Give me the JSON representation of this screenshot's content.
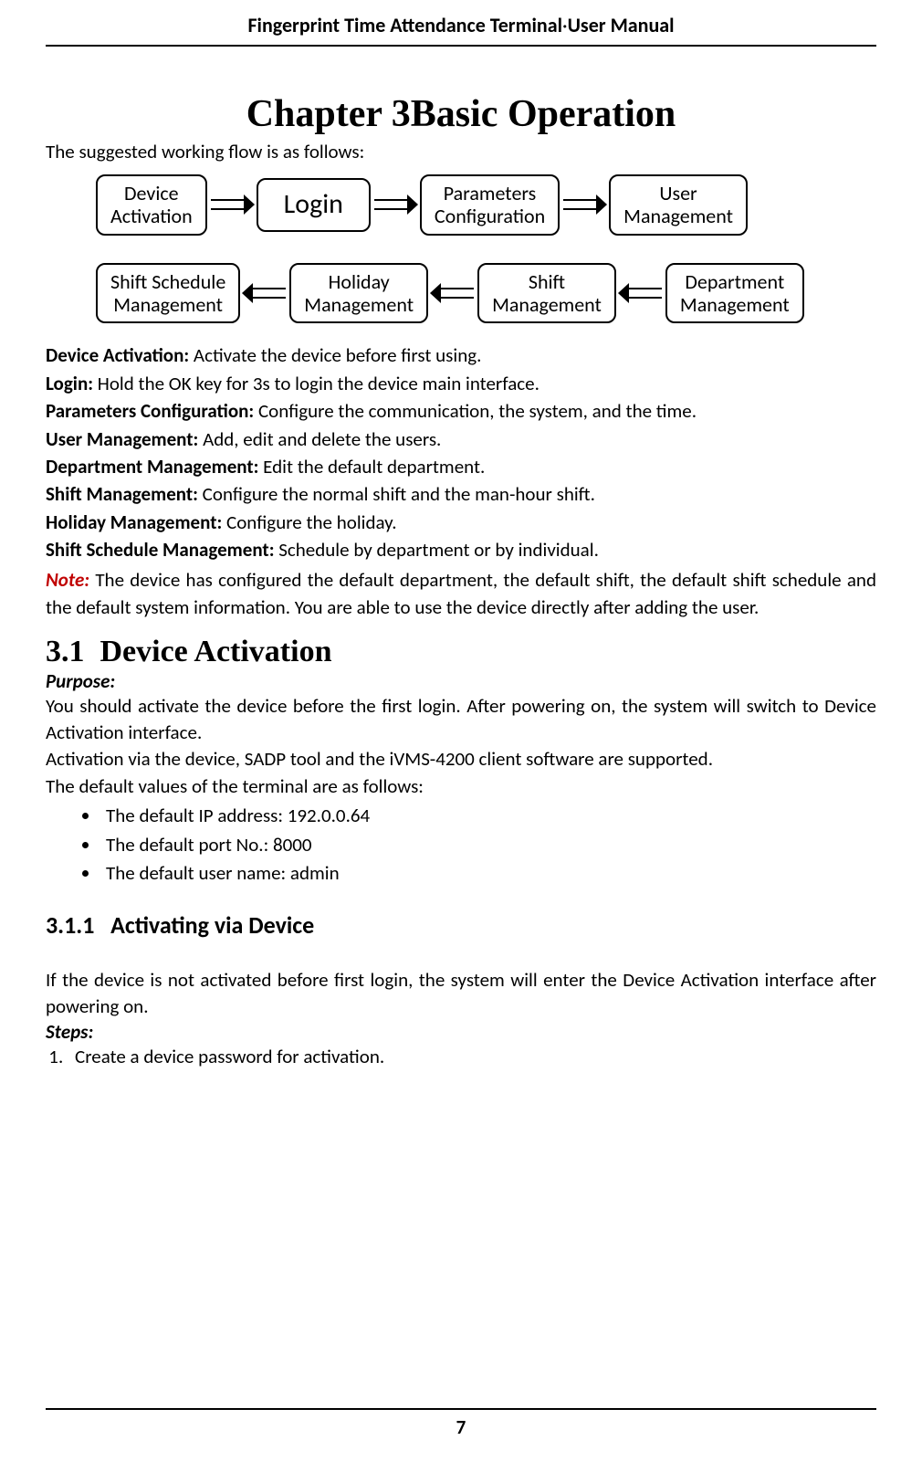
{
  "header": {
    "product": "Fingerprint Time Attendance Terminal",
    "separator": "·",
    "doc": "User Manual"
  },
  "chapter": {
    "label": "Chapter 3",
    "title": "Basic Operation"
  },
  "intro": "The suggested working flow is as follows:",
  "flow": {
    "row1": [
      "Device\nActivation",
      "Login",
      "Parameters\nConfiguration",
      "User\nManagement"
    ],
    "row2": [
      "Shift Schedule\nManagement",
      "Holiday\nManagement",
      "Shift\nManagement",
      "Department\nManagement"
    ]
  },
  "defs": [
    {
      "label": "Device Activation:",
      "text": " Activate the device before first using."
    },
    {
      "label": "Login:",
      "text": " Hold the OK key for 3s to login the device main interface."
    },
    {
      "label": "Parameters Configuration:",
      "text": " Configure the communication, the system, and the time."
    },
    {
      "label": "User Management:",
      "text": " Add, edit and delete the users."
    },
    {
      "label": "Department Management:",
      "text": " Edit the default department."
    },
    {
      "label": "Shift Management:",
      "text": " Configure the normal shift and the man-hour shift."
    },
    {
      "label": "Holiday Management:",
      "text": " Configure the holiday."
    },
    {
      "label": "Shift Schedule Management:",
      "text": " Schedule by department or by individual."
    }
  ],
  "note": {
    "label": "Note:",
    "text": " The device has configured the default department, the default shift, the default shift schedule and the default system information. You are able to use the device directly after adding the user."
  },
  "section": {
    "number": "3.1",
    "title": "Device Activation"
  },
  "purpose": {
    "label": "Purpose:",
    "p1": "You should activate the device before the first login. After powering on, the system will switch to Device Activation interface.",
    "p2": "Activation via the device, SADP tool and the iVMS-4200 client software are supported.",
    "p3": "The default values of the terminal are as follows:"
  },
  "defaults": [
    "The default IP address: 192.0.0.64",
    "The default port No.: 8000",
    "The default user name: admin"
  ],
  "subsection": {
    "number": "3.1.1",
    "title": "Activating via Device"
  },
  "subbody": "If the device is not activated before first login, the system will enter the Device Activation interface after powering on.",
  "steps": {
    "label": "Steps:",
    "items": [
      "Create a device password for activation."
    ]
  },
  "page_number": "7"
}
